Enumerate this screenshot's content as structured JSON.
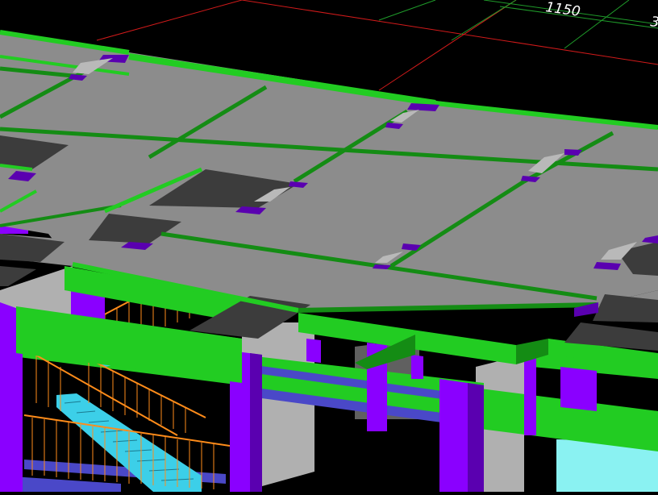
{
  "viewport": {
    "background": "#000000",
    "dimension_labels": {
      "span_a": "1150",
      "span_b": "3"
    }
  },
  "colors": {
    "slab": "#8c8c8c",
    "beam": "#22cc22",
    "beam_dark": "#148c14",
    "column": "#8a00ff",
    "column_dark": "#5a00b0",
    "opening": "#3c3c3c",
    "railing": "#ff8c1a",
    "stair": "#3ccfe8",
    "grid_red": "#d11a1a",
    "grid_green": "#1f9b2a",
    "wall": "#b0b0b0",
    "glass": "#8af2f2",
    "steel": "#4a48c8"
  }
}
